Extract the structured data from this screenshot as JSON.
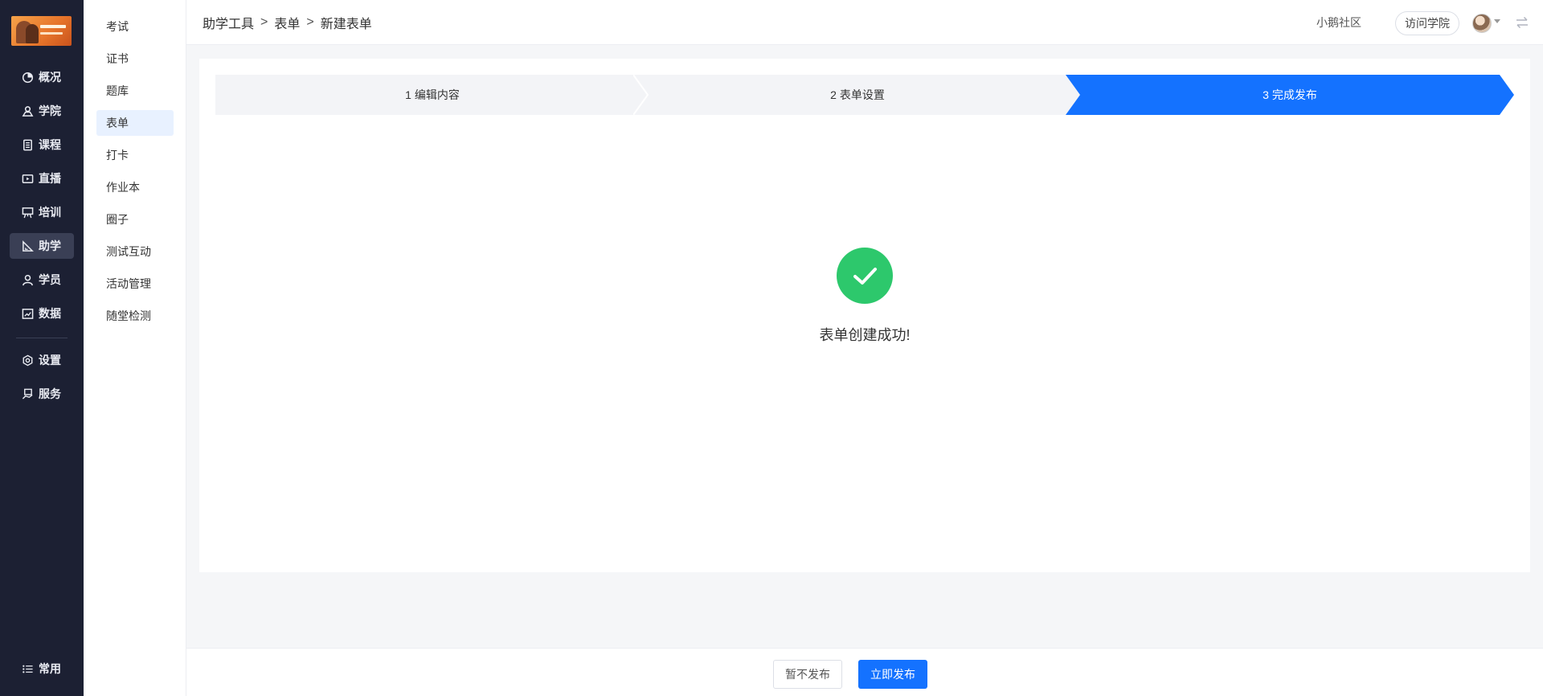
{
  "nav": {
    "items": [
      {
        "label": "概况",
        "icon": "pie-chart-icon"
      },
      {
        "label": "学院",
        "icon": "academy-icon"
      },
      {
        "label": "课程",
        "icon": "course-icon"
      },
      {
        "label": "直播",
        "icon": "live-icon"
      },
      {
        "label": "培训",
        "icon": "training-icon"
      },
      {
        "label": "助学",
        "icon": "assist-icon",
        "active": true
      },
      {
        "label": "学员",
        "icon": "user-icon"
      },
      {
        "label": "数据",
        "icon": "data-icon"
      },
      {
        "label": "设置",
        "icon": "gear-icon"
      },
      {
        "label": "服务",
        "icon": "service-icon"
      }
    ],
    "bottom": {
      "label": "常用",
      "icon": "list-icon"
    }
  },
  "submenu": {
    "items": [
      "考试",
      "证书",
      "题库",
      "表单",
      "打卡",
      "作业本",
      "圈子",
      "测试互动",
      "活动管理",
      "随堂检测"
    ],
    "active": "表单"
  },
  "header": {
    "breadcrumb": [
      "助学工具",
      "表单",
      "新建表单"
    ],
    "separator": ">",
    "community": "小鹅社区",
    "visit_button": "访问学院"
  },
  "steps": [
    {
      "label": "1 编辑内容"
    },
    {
      "label": "2 表单设置"
    },
    {
      "label": "3 完成发布",
      "active": true
    }
  ],
  "result": {
    "message": "表单创建成功!"
  },
  "footer": {
    "secondary_button": "暂不发布",
    "primary_button": "立即发布"
  },
  "colors": {
    "nav_bg": "#1c2033",
    "primary": "#1472ff",
    "success": "#2dc86c",
    "step_inactive": "#f3f4f7"
  }
}
